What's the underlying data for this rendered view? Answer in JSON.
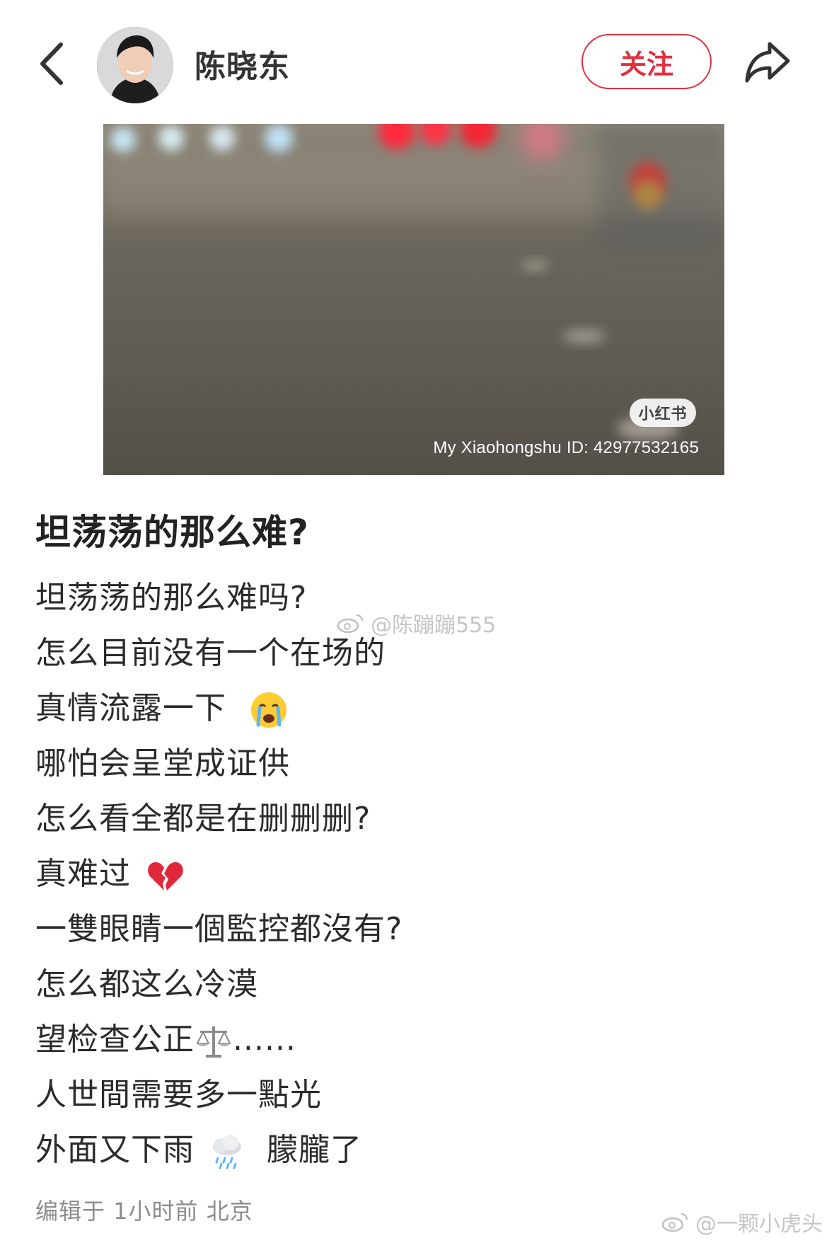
{
  "header": {
    "back_icon": "chevron-left-icon",
    "username": "陈晓东",
    "follow_label": "关注",
    "share_icon": "share-arrow-icon",
    "accent_color": "#e0313f"
  },
  "media": {
    "badge": "小红书",
    "watermark": "My Xiaohongshu ID: 42977532165"
  },
  "post": {
    "title": "坦荡荡的那么难?",
    "lines": [
      "坦荡荡的那么难吗?",
      "怎么目前没有一个在场的",
      "真情流露一下",
      "哪怕会呈堂成证供",
      "怎么看全都是在删删删?",
      "真难过",
      "一雙眼睛一個監控都沒有?",
      "怎么都这么冷漠",
      "望检查公正",
      "人世間需要多一點光",
      "外面又下雨",
      "朦朧了"
    ],
    "line9_suffix": "......",
    "emojis": {
      "line3": "crying-face-icon",
      "line6": "broken-heart-icon",
      "line9": "balance-scale-icon",
      "line11": "rain-cloud-icon"
    },
    "edit_meta": "编辑于 1小时前 北京"
  },
  "watermarks": {
    "weibo_mid": "@陈蹦蹦555",
    "weibo_bottom": "@一颗小虎头"
  }
}
